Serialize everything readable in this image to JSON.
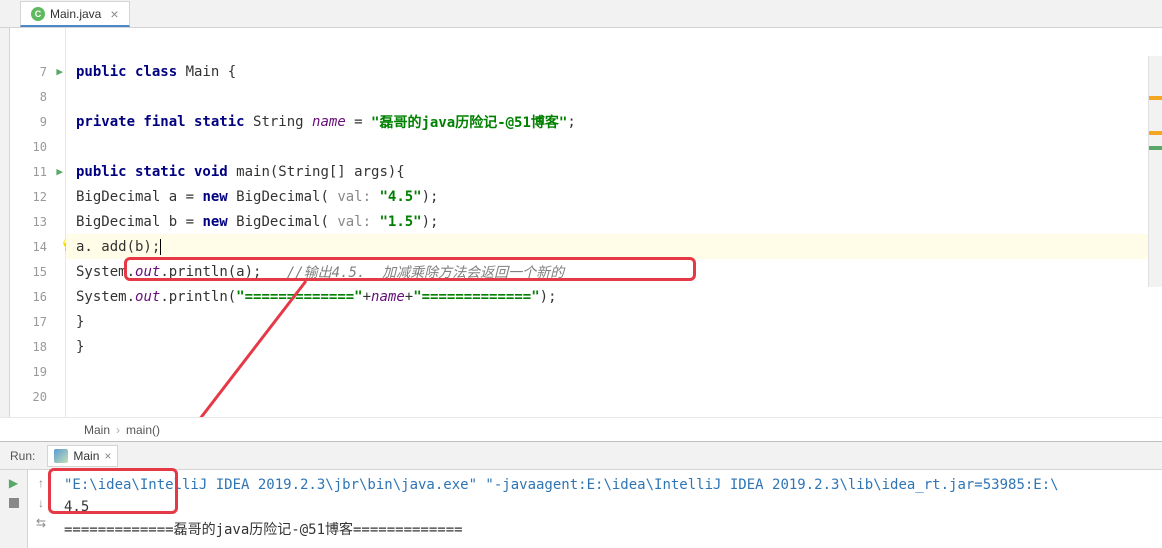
{
  "tab": {
    "filename": "Main.java"
  },
  "gutter": {
    "lines": [
      "",
      "7",
      "8",
      "9",
      "10",
      "11",
      "12",
      "13",
      "14",
      "15",
      "16",
      "17",
      "18",
      "19",
      "20"
    ]
  },
  "code": {
    "l7": {
      "kw1": "public class ",
      "cls": "Main {"
    },
    "l9": {
      "kw": "private final static ",
      "type": "String ",
      "name": "name",
      "eq": " = ",
      "str": "\"磊哥的java历险记-@51博客\"",
      "end": ";"
    },
    "l11": {
      "kw": "public static void ",
      "method": "main(String[] args){"
    },
    "l12": {
      "p1": "BigDecimal a = ",
      "kw": "new ",
      "p2": "BigDecimal( ",
      "hint": "val: ",
      "str": "\"4.5\"",
      "p3": ");"
    },
    "l13": {
      "p1": "BigDecimal b = ",
      "kw": "new ",
      "p2": "BigDecimal( ",
      "hint": "val: ",
      "str": "\"1.5\"",
      "p3": ");"
    },
    "l14": {
      "txt": "a. add(b);"
    },
    "l15": {
      "p1": "System.",
      "out": "out",
      "p2": ".println(a);   ",
      "comment": "//输出4.5.  加减乘除方法会返回一个新的"
    },
    "l16": {
      "p1": "System.",
      "out": "out",
      "p2": ".println(",
      "str1": "\"=============\"",
      "plus1": "+",
      "name": "name",
      "plus2": "+",
      "str2": "\"=============\"",
      "p3": ");"
    },
    "l17": {
      "txt": "}"
    },
    "l18": {
      "txt": "}"
    }
  },
  "breadcrumb": {
    "class": "Main",
    "method": "main()"
  },
  "run": {
    "label": "Run:",
    "tabName": "Main"
  },
  "console": {
    "cmd": "\"E:\\idea\\IntelliJ IDEA 2019.2.3\\jbr\\bin\\java.exe\" \"-javaagent:E:\\idea\\IntelliJ IDEA 2019.2.3\\lib\\idea_rt.jar=53985:E:\\",
    "out1": "4.5",
    "out2": "=============磊哥的java历险记-@51博客============="
  }
}
